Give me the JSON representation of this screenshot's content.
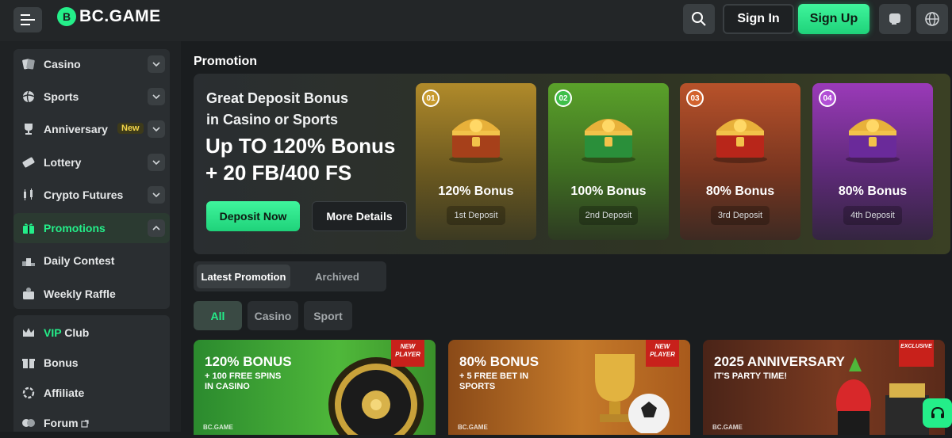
{
  "header": {
    "logo_text": "BC.GAME",
    "signin_label": "Sign In",
    "signup_label": "Sign Up"
  },
  "sidebar": {
    "items": [
      {
        "label": "Casino",
        "icon": "cards-icon"
      },
      {
        "label": "Sports",
        "icon": "ball-icon"
      },
      {
        "label": "Anniversary",
        "icon": "trophy-icon",
        "badge": "New"
      },
      {
        "label": "Lottery",
        "icon": "ticket-icon"
      },
      {
        "label": "Crypto Futures",
        "icon": "candles-icon"
      },
      {
        "label": "Promotions",
        "icon": "gift-icon"
      },
      {
        "label": "Daily Contest",
        "icon": "podium-icon"
      },
      {
        "label": "Weekly Raffle",
        "icon": "raffle-icon"
      }
    ],
    "items2": [
      {
        "label": "VIP Club",
        "label_prefix": "VIP",
        "label_rest": " Club",
        "icon": "crown-icon"
      },
      {
        "label": "Bonus",
        "icon": "gift-box-icon"
      },
      {
        "label": "Affiliate",
        "icon": "affiliate-icon"
      },
      {
        "label": "Forum",
        "icon": "forum-icon"
      }
    ]
  },
  "main": {
    "page_title": "Promotion",
    "hero": {
      "subtitle_line1": "Great Deposit Bonus",
      "subtitle_line2": "in Casino or Sports",
      "headline_line1": "Up TO 120% Bonus",
      "headline_line2": "+ 20 FB/400 FS",
      "deposit_label": "Deposit Now",
      "details_label": "More Details",
      "cards": [
        {
          "num": "01",
          "title": "120% Bonus",
          "tag": "1st Deposit"
        },
        {
          "num": "02",
          "title": "100% Bonus",
          "tag": "2nd Deposit"
        },
        {
          "num": "03",
          "title": "80% Bonus",
          "tag": "3rd Deposit"
        },
        {
          "num": "04",
          "title": "80% Bonus",
          "tag": "4th Deposit"
        }
      ]
    },
    "tabs": [
      "Latest Promotion",
      "Archived"
    ],
    "filters": [
      "All",
      "Casino",
      "Sport"
    ],
    "promos": [
      {
        "title": "120% BONUS",
        "sub1": "+ 100 FREE SPINS",
        "sub2": "IN CASINO",
        "ribbon1": "NEW",
        "ribbon2": "PLAYER",
        "brand": "BC.GAME"
      },
      {
        "title": "80% BONUS",
        "sub1": "+ 5 FREE BET IN",
        "sub2": "SPORTS",
        "ribbon1": "NEW",
        "ribbon2": "PLAYER",
        "brand": "BC.GAME"
      },
      {
        "title": "2025 ANNIVERSARY",
        "sub1": "IT'S PARTY TIME!",
        "sub2": "",
        "ribbon1": "EXCLUSIVE",
        "ribbon2": "",
        "brand": "BC.GAME"
      }
    ]
  },
  "colors": {
    "accent": "#24ee89",
    "background": "#1a1d1f",
    "panel": "#2a2e31"
  }
}
